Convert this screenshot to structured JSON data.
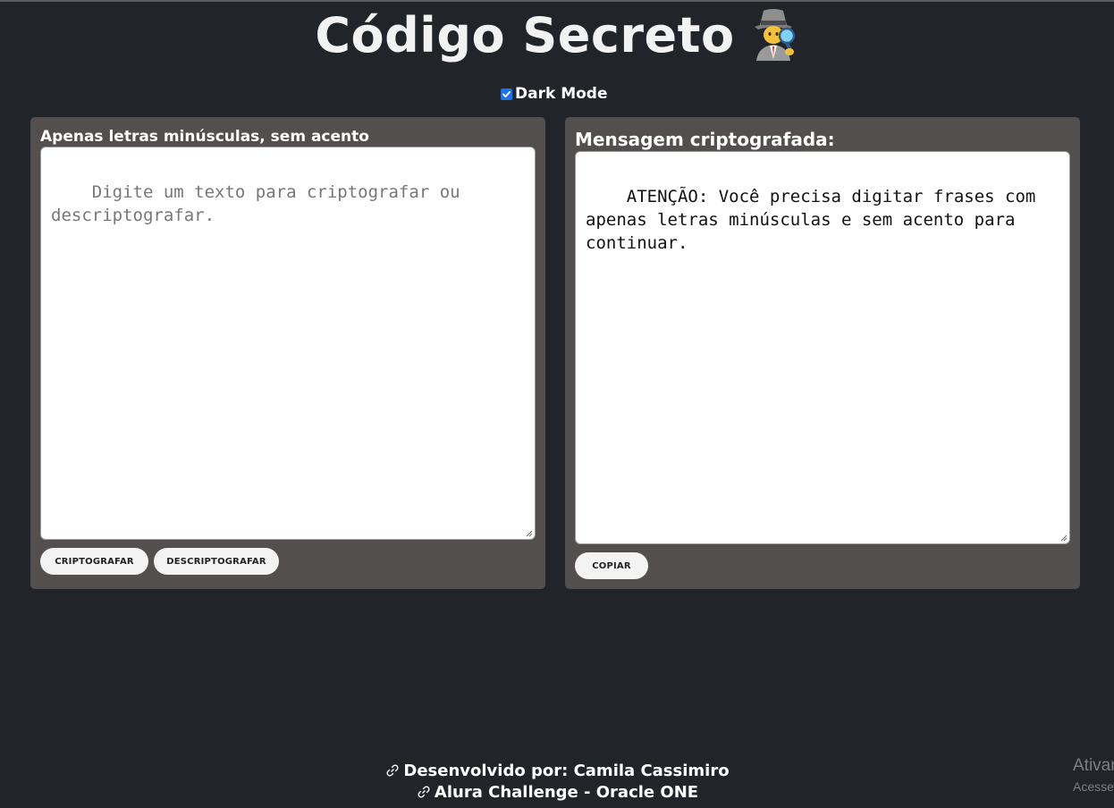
{
  "header": {
    "title": "Código Secreto",
    "emoji_icon": "detective-emoji-icon"
  },
  "dark_mode": {
    "label": "Dark Mode",
    "checked": true,
    "accent_color": "#1a73e8"
  },
  "input_panel": {
    "label": "Apenas letras minúsculas, sem acento",
    "placeholder": "Digite um texto para criptografar ou descriptografar.",
    "value": "",
    "buttons": {
      "encrypt": "CRIPTOGRAFAR",
      "decrypt": "DESCRIPTOGRAFAR"
    }
  },
  "output_panel": {
    "label": "Mensagem criptografada:",
    "value": "ATENÇÃO: Você precisa digitar frases com apenas letras minúsculas e sem acento para continuar.",
    "copy_button": "COPIAR"
  },
  "footer": {
    "line1": "Desenvolvido por: Camila Cassimiro",
    "line2": "Alura Challenge - Oracle ONE",
    "icon": "link-icon"
  },
  "watermark": {
    "line1": "Ativar",
    "line2": "Acesse"
  },
  "colors": {
    "background": "#212429",
    "panel": "#534f4e",
    "text": "#ffffff",
    "button": "#f3f3f3"
  }
}
